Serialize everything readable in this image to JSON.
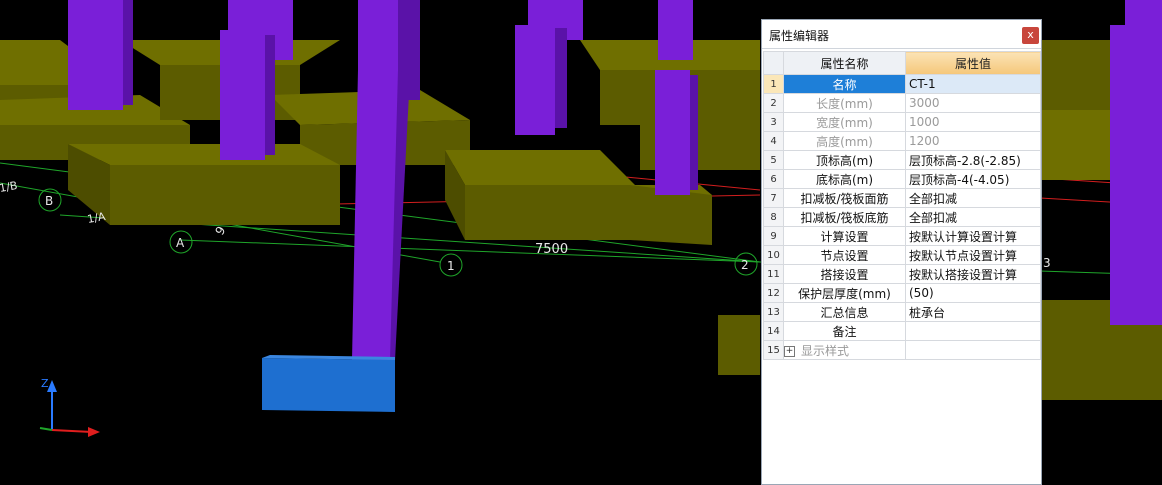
{
  "panel": {
    "title": "属性编辑器",
    "close_label": "x",
    "col_name": "属性名称",
    "col_value": "属性值",
    "rows": [
      {
        "n": "1",
        "name": "名称",
        "value": "CT-1"
      },
      {
        "n": "2",
        "name": "长度(mm)",
        "value": "3000"
      },
      {
        "n": "3",
        "name": "宽度(mm)",
        "value": "1000"
      },
      {
        "n": "4",
        "name": "高度(mm)",
        "value": "1200"
      },
      {
        "n": "5",
        "name": "顶标高(m)",
        "value": "层顶标高-2.8(-2.85)"
      },
      {
        "n": "6",
        "name": "底标高(m)",
        "value": "层顶标高-4(-4.05)"
      },
      {
        "n": "7",
        "name": "扣减板/筏板面筋",
        "value": "全部扣减"
      },
      {
        "n": "8",
        "name": "扣减板/筏板底筋",
        "value": "全部扣减"
      },
      {
        "n": "9",
        "name": "计算设置",
        "value": "按默认计算设置计算"
      },
      {
        "n": "10",
        "name": "节点设置",
        "value": "按默认节点设置计算"
      },
      {
        "n": "11",
        "name": "搭接设置",
        "value": "按默认搭接设置计算"
      },
      {
        "n": "12",
        "name": "保护层厚度(mm)",
        "value": "(50)"
      },
      {
        "n": "13",
        "name": "汇总信息",
        "value": "桩承台"
      },
      {
        "n": "14",
        "name": "备注",
        "value": ""
      },
      {
        "n": "15",
        "name": "显示样式",
        "value": "",
        "expand": "+"
      }
    ]
  },
  "viewport": {
    "dimension_label": "7500",
    "axis_labels": [
      "A",
      "B",
      "1",
      "2",
      "3",
      "1/A",
      "1/B"
    ],
    "dim_fragment": "9",
    "axis_names": {
      "z": "Z"
    }
  },
  "colors": {
    "cap_top": "#6f6f00",
    "cap_side": "#5c5c00",
    "column": "#7a1fd8",
    "column_dark": "#5a12a8",
    "selected_cap": "#1e6fd0",
    "grid_line": "#1fa52a",
    "red_line": "#d21e1e"
  }
}
